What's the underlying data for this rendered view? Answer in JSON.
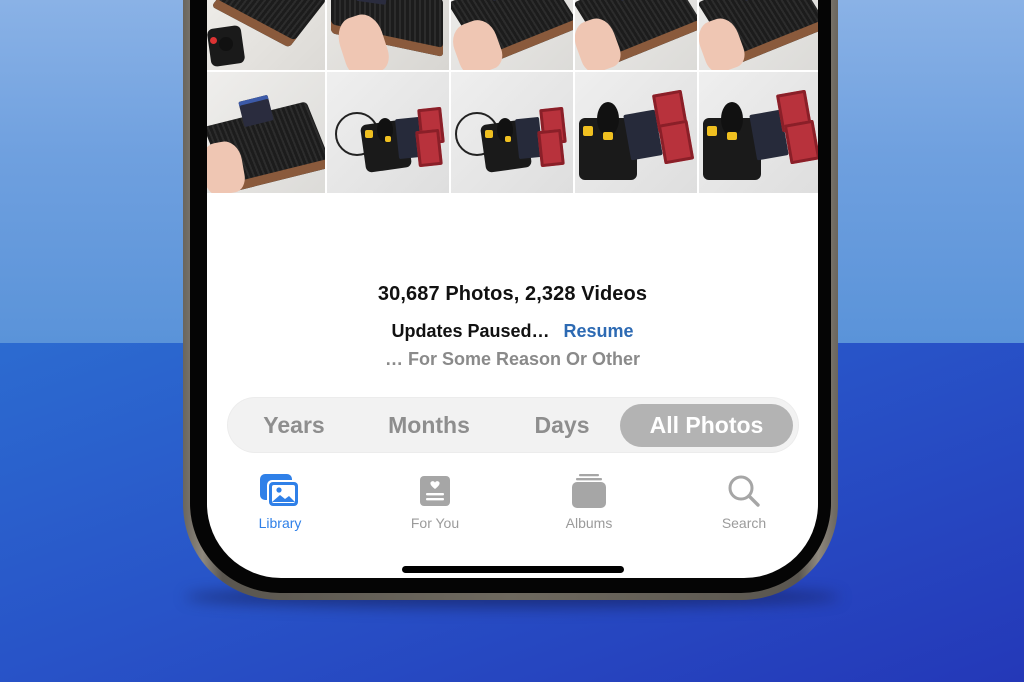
{
  "background": {
    "top_color": "#7aa8e2",
    "bottom_color": "#2a52c6"
  },
  "library": {
    "photo_grid": {
      "columns": 5,
      "rows": [
        {
          "row": "partial-top",
          "thumbs": [
            "atari-console",
            "atari-console",
            "atari-console",
            "atari-console",
            "atari-console"
          ]
        },
        {
          "row": 1,
          "thumbs": [
            "atari-console-with-joystick",
            "hand-holding-atari-console",
            "hand-holding-atari-console",
            "hand-holding-atari-console",
            "hand-holding-atari-console"
          ]
        },
        {
          "row": 2,
          "thumbs": [
            "hand-holding-atari-console",
            "joystick-and-game-cartridges",
            "joystick-and-game-cartridges",
            "joystick-and-game-cartridges",
            "joystick-and-game-cartridges"
          ]
        }
      ]
    },
    "counts_text": "30,687 Photos, 2,328 Videos",
    "status": {
      "text": "Updates Paused…",
      "action_label": "Resume",
      "subtext": "… For Some Reason Or Other"
    },
    "view_selector": {
      "options": [
        "Years",
        "Months",
        "Days",
        "All Photos"
      ],
      "selected": "All Photos"
    }
  },
  "tab_bar": {
    "active_color": "#2f80e8",
    "inactive_color": "#9b9b9b",
    "items": [
      {
        "label": "Library",
        "icon": "photo-library-icon",
        "active": true
      },
      {
        "label": "For You",
        "icon": "for-you-icon",
        "active": false
      },
      {
        "label": "Albums",
        "icon": "albums-stack-icon",
        "active": false
      },
      {
        "label": "Search",
        "icon": "magnifier-icon",
        "active": false
      }
    ]
  }
}
